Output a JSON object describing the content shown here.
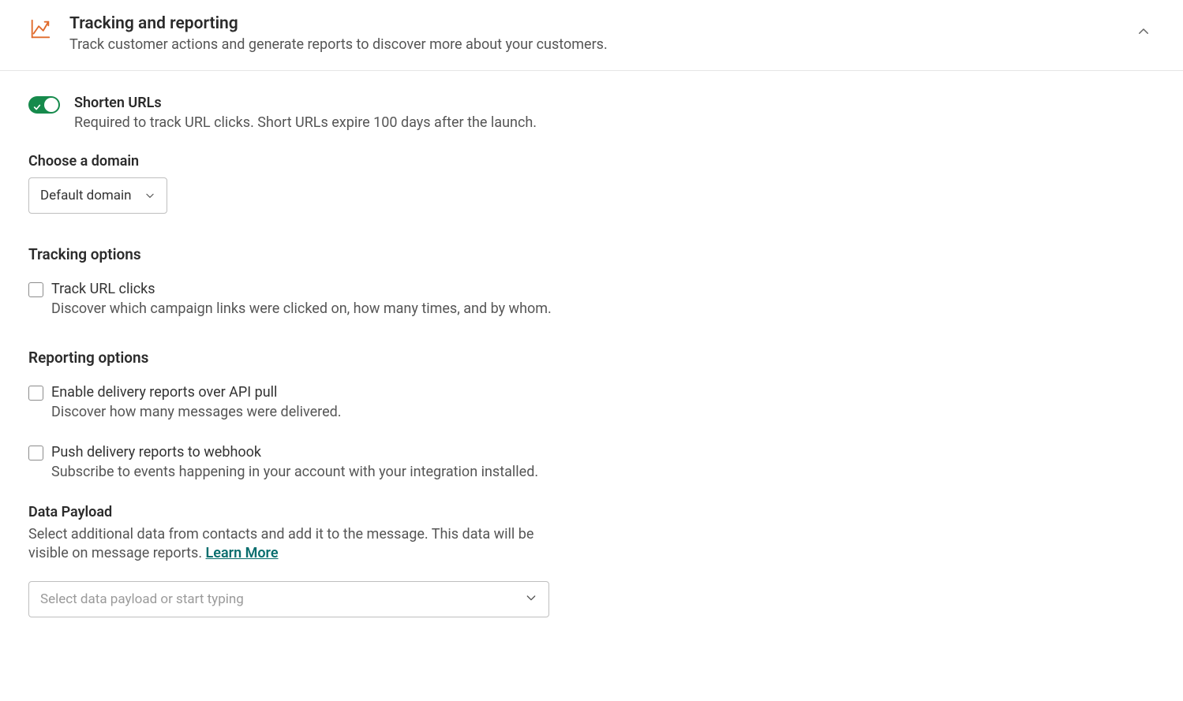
{
  "header": {
    "title": "Tracking and reporting",
    "subtitle": "Track customer actions and generate reports to discover more about your customers."
  },
  "shortenUrls": {
    "title": "Shorten URLs",
    "desc": "Required to track URL clicks. Short URLs expire 100 days after the launch."
  },
  "chooseDomain": {
    "label": "Choose a domain",
    "selected": "Default domain"
  },
  "trackingOptions": {
    "heading": "Tracking options",
    "trackUrlClicks": {
      "title": "Track URL clicks",
      "desc": "Discover which campaign links were clicked on, how many times, and by whom."
    }
  },
  "reportingOptions": {
    "heading": "Reporting options",
    "apiPull": {
      "title": "Enable delivery reports over API pull",
      "desc": "Discover how many messages were delivered."
    },
    "webhook": {
      "title": "Push delivery reports to webhook",
      "desc": "Subscribe to events happening in your account with your integration installed."
    }
  },
  "dataPayload": {
    "label": "Data Payload",
    "desc": "Select additional data from contacts and add it to the message. This data will be visible on message reports. ",
    "learnMore": "Learn More",
    "placeholder": "Select data payload or start typing"
  }
}
